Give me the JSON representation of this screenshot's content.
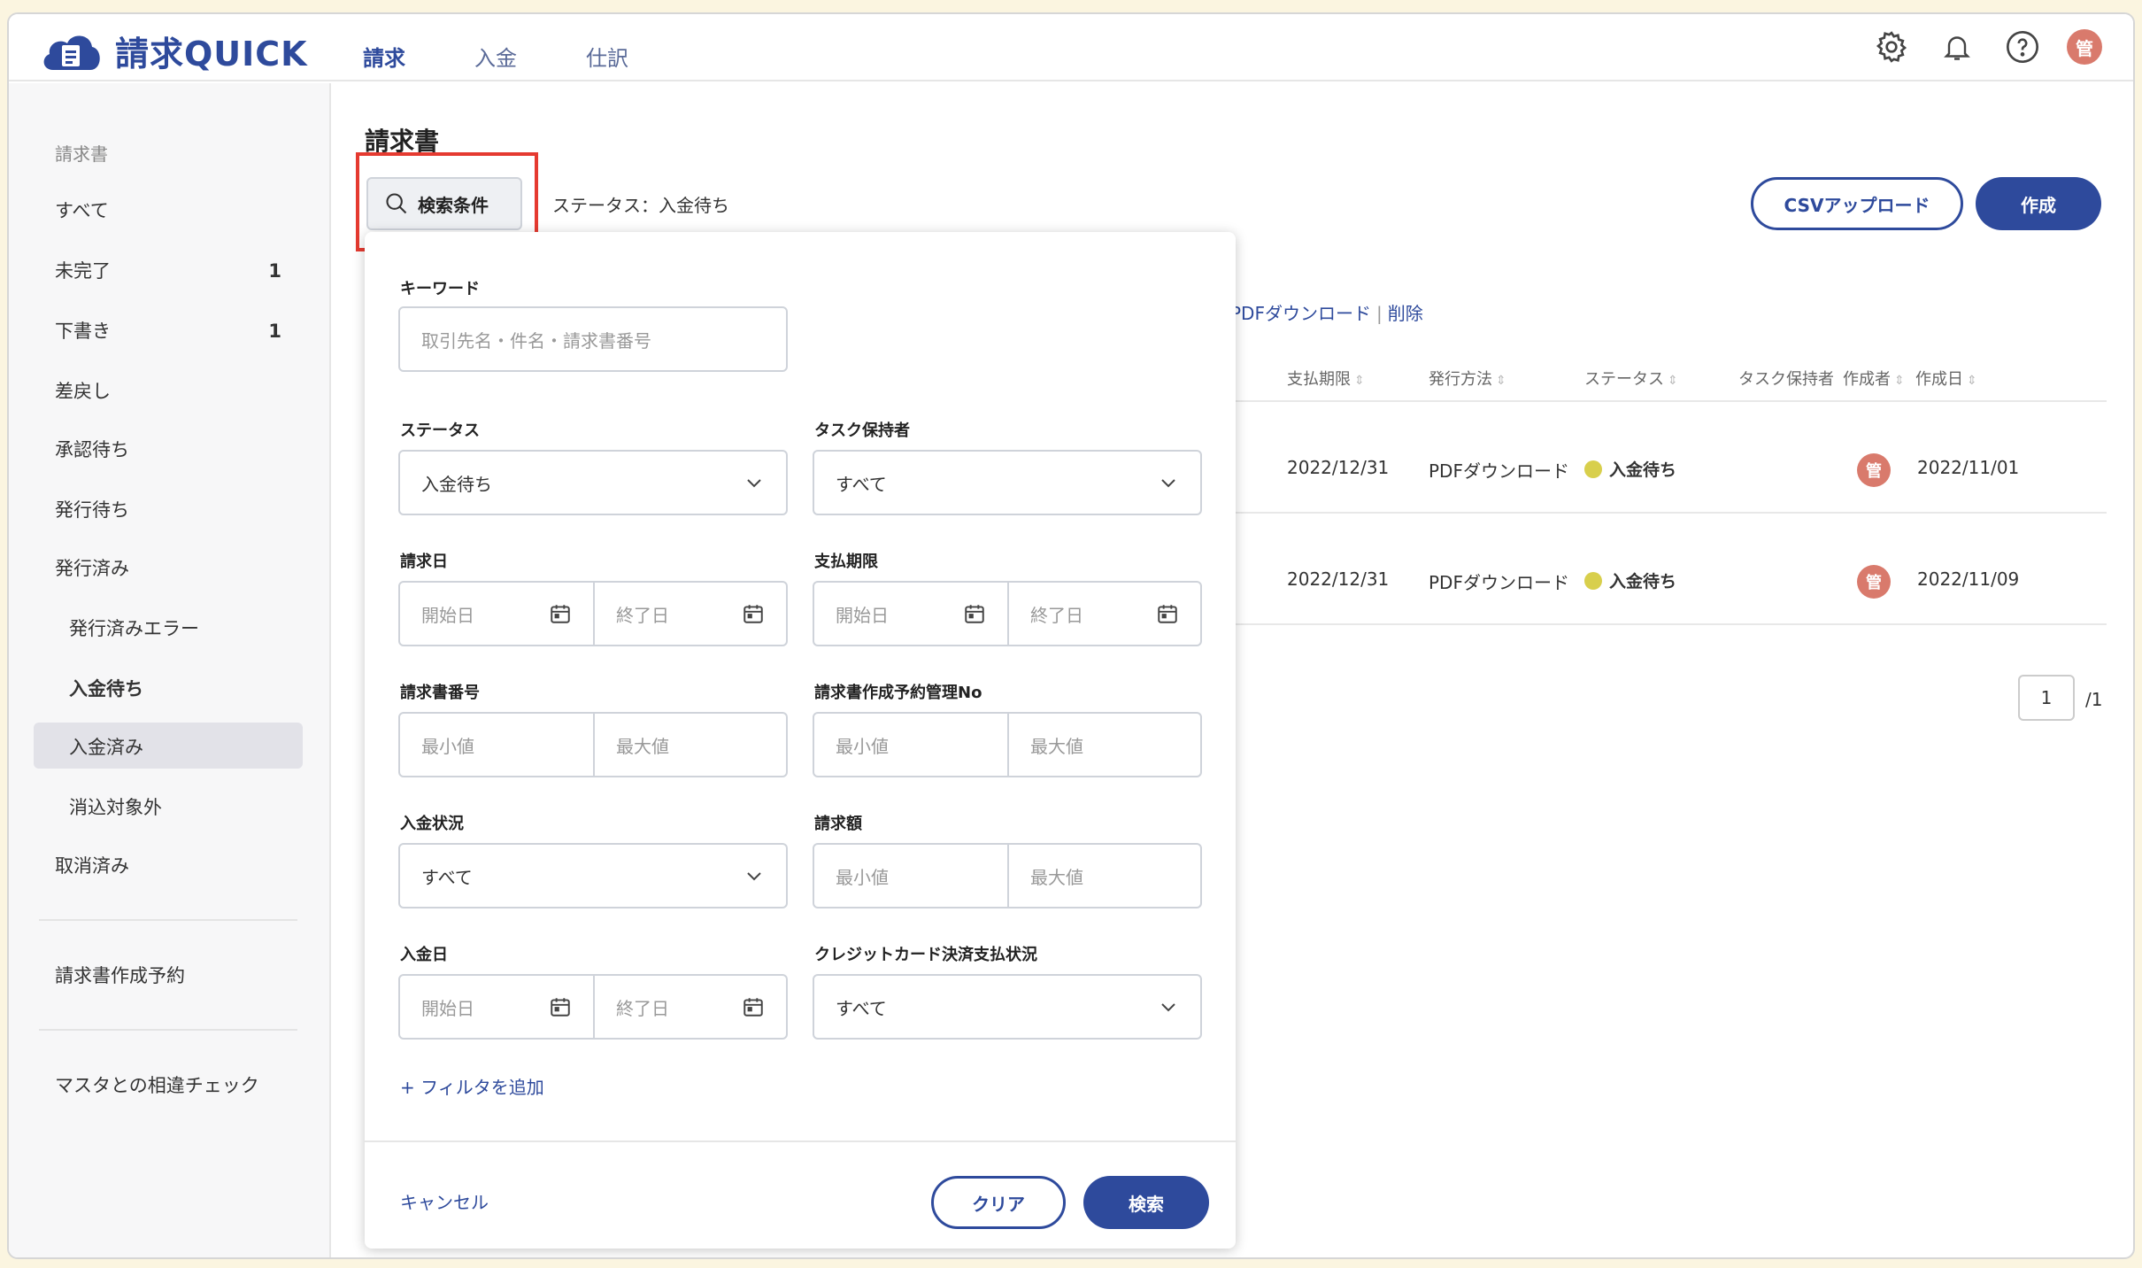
{
  "app": {
    "name": "請求QUICK"
  },
  "nav": {
    "items": [
      "請求",
      "入金",
      "仕訳"
    ],
    "active": "請求"
  },
  "header_icons": {
    "settings": "gear-icon",
    "notifications": "bell-icon",
    "help": "help-circle-icon",
    "avatar": "管"
  },
  "sidebar": {
    "section": "請求書",
    "items": [
      {
        "label": "すべて"
      },
      {
        "label": "未完了",
        "count": "1"
      },
      {
        "label": "下書き",
        "count": "1"
      },
      {
        "label": "差戻し"
      },
      {
        "label": "承認待ち"
      },
      {
        "label": "発行待ち"
      },
      {
        "label": "発行済み"
      },
      {
        "label": "発行済みエラー"
      },
      {
        "label": "入金待ち"
      },
      {
        "label": "入金済み"
      },
      {
        "label": "消込対象外"
      },
      {
        "label": "取消済み"
      }
    ],
    "reservation": "請求書作成予約",
    "master_check": "マスタとの相違チェック"
  },
  "main": {
    "title": "請求書",
    "search_button": "検索条件",
    "status_summary": "ステータス：入金待ち",
    "csv_upload": "CSVアップロード",
    "create": "作成",
    "bulk_pdf": "PDFダウンロード",
    "bulk_sep": "|",
    "bulk_delete": "削除",
    "columns": [
      "支払期限",
      "発行方法",
      "ステータス",
      "タスク保持者",
      "作成者",
      "作成日"
    ],
    "rows": [
      {
        "due": "2022/12/31",
        "method": "PDFダウンロード",
        "status": "入金待ち",
        "creator": "管",
        "created": "2022/11/01"
      },
      {
        "due": "2022/12/31",
        "method": "PDFダウンロード",
        "status": "入金待ち",
        "creator": "管",
        "created": "2022/11/09"
      }
    ],
    "pager": {
      "page": "1",
      "total": "/1"
    }
  },
  "filter": {
    "keyword": {
      "label": "キーワード",
      "placeholder": "取引先名・件名・請求書番号"
    },
    "status": {
      "label": "ステータス",
      "value": "入金待ち"
    },
    "task_holder": {
      "label": "タスク保持者",
      "value": "すべて"
    },
    "invoice_date": {
      "label": "請求日",
      "start": "開始日",
      "end": "終了日"
    },
    "due_date": {
      "label": "支払期限",
      "start": "開始日",
      "end": "終了日"
    },
    "invoice_no": {
      "label": "請求書番号",
      "min": "最小値",
      "max": "最大値"
    },
    "reservation_no": {
      "label": "請求書作成予約管理No",
      "min": "最小値",
      "max": "最大値"
    },
    "payment_status": {
      "label": "入金状況",
      "value": "すべて"
    },
    "amount": {
      "label": "請求額",
      "min": "最小値",
      "max": "最大値"
    },
    "payment_date": {
      "label": "入金日",
      "start": "開始日",
      "end": "終了日"
    },
    "credit_status": {
      "label": "クレジットカード決済支払状況",
      "value": "すべて"
    },
    "add_filter": "+ フィルタを追加",
    "cancel": "キャンセル",
    "clear": "クリア",
    "search": "検索"
  },
  "colors": {
    "brand": "#2e4a9c",
    "status_dot": "#d8cf4c",
    "avatar": "#d97a6c",
    "highlight": "#e53a30"
  }
}
